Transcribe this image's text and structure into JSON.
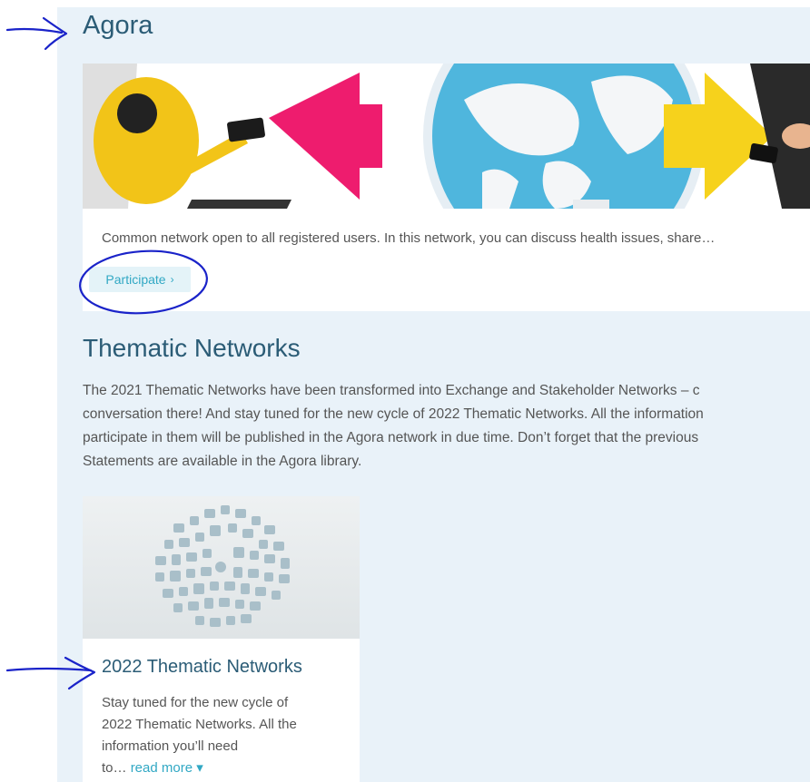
{
  "agora": {
    "title": "Agora",
    "description": "Common network open to all registered users. In this network, you can discuss health issues, share…",
    "participate_label": "Participate",
    "participate_chevron": "›"
  },
  "thematic": {
    "title": "Thematic Networks",
    "lines": [
      "The 2021 Thematic Networks have been transformed into Exchange and Stakeholder Networks – c",
      "conversation there! And stay tuned for the new cycle of 2022 Thematic Networks. All the information",
      "participate in them will be published in the Agora network in due time. Don’t forget that the previous",
      "Statements are available in the Agora library."
    ]
  },
  "card": {
    "title": "2022 Thematic Networks",
    "desc_lines": [
      "Stay tuned for the new cycle of",
      "2022 Thematic Networks. All the",
      "information you’ll need",
      "to…"
    ],
    "read_more": "read more",
    "read_more_caret": "▾"
  },
  "colors": {
    "panel_bg": "#e9f2f9",
    "heading": "#2b5c76",
    "accent": "#31a8c4",
    "annotation_ink": "#1a23c9"
  },
  "icons": [
    "arrow-left-icon",
    "arrow-right-icon",
    "globe-icon",
    "chevron-right-icon",
    "caret-down-icon",
    "annotation-arrow-icon"
  ]
}
